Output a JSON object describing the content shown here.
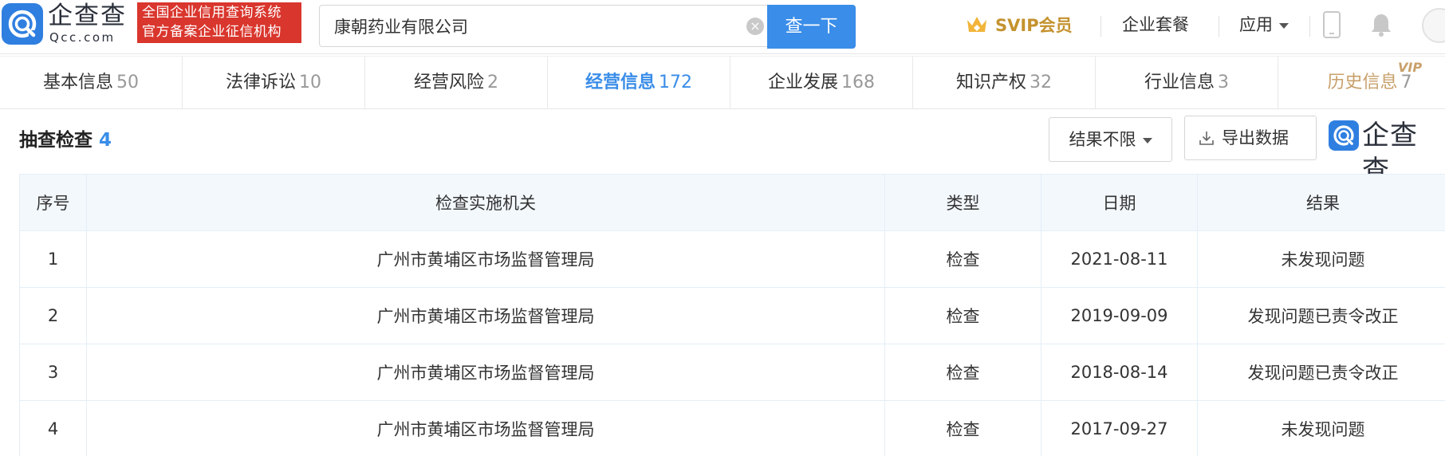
{
  "header": {
    "logo_text": "企查查",
    "logo_sub": "Qcc.com",
    "tag_line1": "全国企业信用查询系统",
    "tag_line2": "官方备案企业征信机构",
    "search_value": "康朝药业有限公司",
    "clear_symbol": "×",
    "search_button": "查一下",
    "svip_label": "SVIP会员",
    "nav_package": "企业套餐",
    "nav_apps": "应用"
  },
  "tabs": [
    {
      "label": "基本信息",
      "count": "50"
    },
    {
      "label": "法律诉讼",
      "count": "10"
    },
    {
      "label": "经营风险",
      "count": "2"
    },
    {
      "label": "经营信息",
      "count": "172"
    },
    {
      "label": "企业发展",
      "count": "168"
    },
    {
      "label": "知识产权",
      "count": "32"
    },
    {
      "label": "行业信息",
      "count": "3"
    },
    {
      "label": "历史信息",
      "count": "7",
      "badge": "VIP"
    }
  ],
  "section": {
    "title": "抽查检查",
    "count": "4",
    "filter_label": "结果不限",
    "export_label": "导出数据",
    "brand_text": "企查查"
  },
  "table": {
    "columns": [
      "序号",
      "检查实施机关",
      "类型",
      "日期",
      "结果"
    ],
    "rows": [
      {
        "idx": "1",
        "org": "广州市黄埔区市场监督管理局",
        "type": "检查",
        "date": "2021-08-11",
        "result": "未发现问题",
        "warn": false
      },
      {
        "idx": "2",
        "org": "广州市黄埔区市场监督管理局",
        "type": "检查",
        "date": "2019-09-09",
        "result": "发现问题已责令改正",
        "warn": true
      },
      {
        "idx": "3",
        "org": "广州市黄埔区市场监督管理局",
        "type": "检查",
        "date": "2018-08-14",
        "result": "发现问题已责令改正",
        "warn": true
      },
      {
        "idx": "4",
        "org": "广州市黄埔区市场监督管理局",
        "type": "检查",
        "date": "2017-09-27",
        "result": "未发现问题",
        "warn": false
      }
    ]
  },
  "colors": {
    "accent": "#3a8de8",
    "warn": "#e8544a",
    "vip_gold": "#c4922e",
    "tag_red": "#d9362d"
  },
  "icons": [
    "qcc-logo-icon",
    "clear-icon",
    "crown-icon",
    "phone-icon",
    "bell-icon",
    "download-icon"
  ]
}
